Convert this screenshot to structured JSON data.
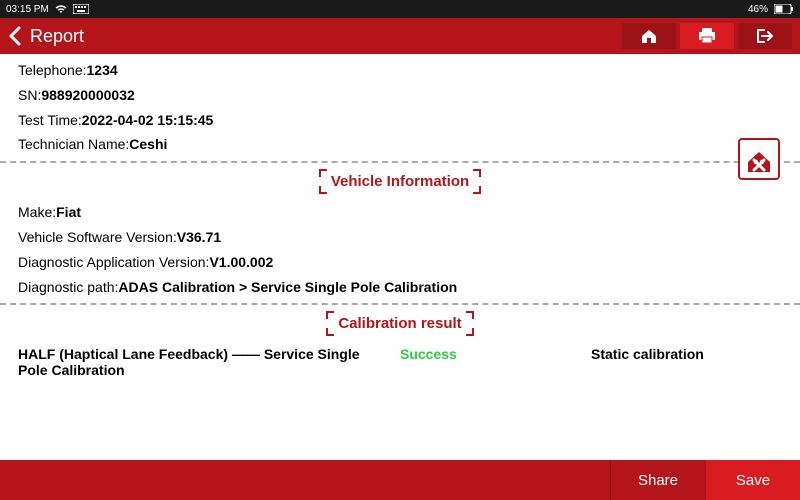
{
  "statusbar": {
    "time": "03:15 PM",
    "battery": "46%"
  },
  "titlebar": {
    "title": "Report"
  },
  "info": {
    "telephone_label": "Telephone:",
    "telephone_value": "1234",
    "sn_label": "SN:",
    "sn_value": "988920000032",
    "test_time_label": "Test Time:",
    "test_time_value": "2022-04-02 15:15:45",
    "technician_label": "Technician Name:",
    "technician_value": "Ceshi"
  },
  "sections": {
    "vehicle_info": "Vehicle Information",
    "calibration_result": "Calibration result"
  },
  "vehicle": {
    "make_label": "Make:",
    "make_value": "Fiat",
    "sw_label": "Vehicle Software Version:",
    "sw_value": "V36.71",
    "diag_app_label": "Diagnostic Application Version:",
    "diag_app_value": "V1.00.002",
    "diag_path_label": "Diagnostic path:",
    "diag_path_value": "ADAS Calibration > Service Single Pole Calibration"
  },
  "result": {
    "name": "HALF (Haptical Lane Feedback) —— Service Single Pole Calibration",
    "status": "Success",
    "type": "Static calibration"
  },
  "bottombar": {
    "share": "Share",
    "save": "Save"
  }
}
